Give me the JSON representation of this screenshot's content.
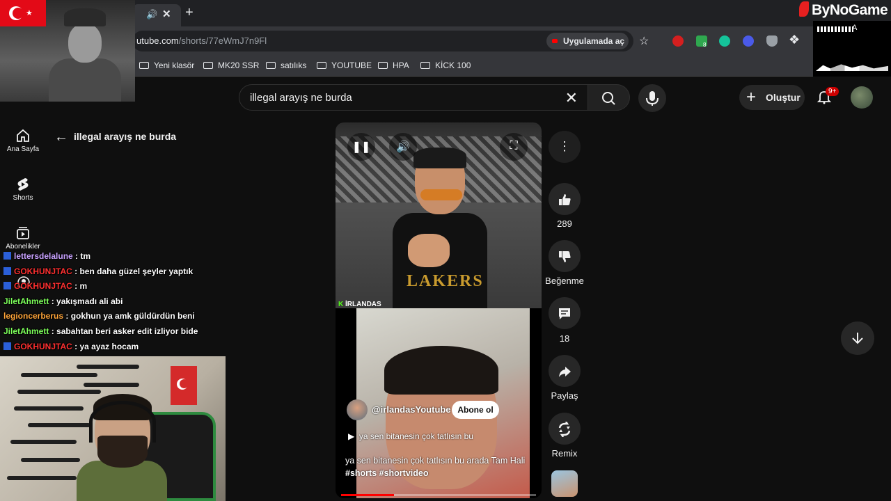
{
  "browser": {
    "url_host": "utube.com",
    "url_path": "/shorts/77eWmJ7n9Fl",
    "open_in_app": "Uygulamada aç",
    "extension_badge": "8",
    "bookmarks": [
      "Yeni klasör",
      "MK20 SSR",
      "satılıks",
      "YOUTUBE",
      "HPA",
      "KİCK 100"
    ]
  },
  "youtube": {
    "search_query": "illegal arayış ne burda",
    "create_label": "Oluştur",
    "notification_count": "9+",
    "rail": [
      {
        "label": "Ana Sayfa",
        "icon": "home-icon"
      },
      {
        "label": "Shorts",
        "icon": "shorts-icon"
      },
      {
        "label": "Abonelikler",
        "icon": "subscriptions-icon"
      }
    ],
    "back_title": "illegal arayış ne burda"
  },
  "short": {
    "overlay_tag_prefix": "K",
    "overlay_tag": "İRLANDAS",
    "jersey_text": "LAKERS",
    "channel": "@irlandasYoutube",
    "subscribe_label": "Abone ol",
    "sound": "ya sen bitanesin çok tatlısın bu",
    "description": "ya sen bitanesin çok tatlısın bu arada Tam Hali",
    "hashtags": "#shorts #shortvideo",
    "progress": 0.27
  },
  "actions": {
    "like_count": "289",
    "dislike_label": "Beğenme",
    "comment_count": "18",
    "share_label": "Paylaş",
    "remix_label": "Remix"
  },
  "chat": [
    {
      "user": "lettersdelalune",
      "color": "#c8a2ff",
      "text": ": tm",
      "badge": true
    },
    {
      "user": "GOKHUNJTAC",
      "color": "#ff3030",
      "text": ": ben daha güzel şeyler yaptık",
      "badge": true
    },
    {
      "user": "GOKHUNJTAC",
      "color": "#ff3030",
      "text": ": m",
      "badge": true
    },
    {
      "user": "JiletAhmett",
      "color": "#7dff5a",
      "text": ": yakışmadı ali abi",
      "badge": false
    },
    {
      "user": "legioncerberus",
      "color": "#ffa53a",
      "text": ": gokhun ya amk güldürdün beni",
      "badge": false
    },
    {
      "user": "JiletAhmett",
      "color": "#7dff5a",
      "text": ": sabahtan beri asker edit izliyor bide",
      "badge": false
    },
    {
      "user": "GOKHUNJTAC",
      "color": "#ff3030",
      "text": ": ya ayaz hocam",
      "badge": true
    }
  ],
  "stream": {
    "brand": "ByNoGame",
    "brand_corner_letter": "A"
  },
  "colors": {
    "yt_red": "#ff0000",
    "kick_green": "#53fc18",
    "turkish_red": "#e30a17"
  }
}
